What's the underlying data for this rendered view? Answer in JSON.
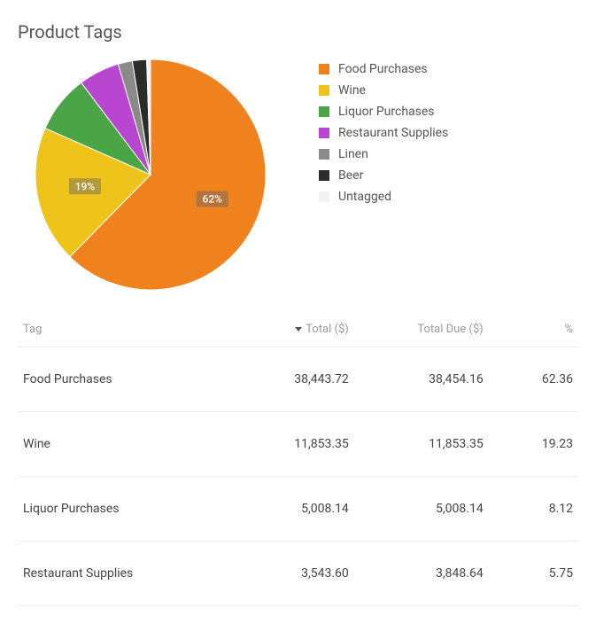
{
  "title": "Product Tags",
  "chart_data": {
    "type": "pie",
    "title": "Product Tags",
    "series": [
      {
        "name": "Food Purchases",
        "percent": 62.36,
        "color": "#f0821e"
      },
      {
        "name": "Wine",
        "percent": 19.23,
        "color": "#eec31a"
      },
      {
        "name": "Liquor Purchases",
        "percent": 8.12,
        "color": "#4aa547"
      },
      {
        "name": "Restaurant Supplies",
        "percent": 5.75,
        "color": "#b946d1"
      },
      {
        "name": "Linen",
        "percent": 2.0,
        "color": "#8a8a8a"
      },
      {
        "name": "Beer",
        "percent": 2.0,
        "color": "#2c2c2c"
      },
      {
        "name": "Untagged",
        "percent": 0.54,
        "color": "#f2f2f2"
      }
    ],
    "visible_labels": [
      {
        "text": "62%",
        "for": "Food Purchases"
      },
      {
        "text": "19%",
        "for": "Wine"
      }
    ]
  },
  "legend": [
    {
      "label": "Food Purchases",
      "color": "#f0821e"
    },
    {
      "label": "Wine",
      "color": "#eec31a"
    },
    {
      "label": "Liquor Purchases",
      "color": "#4aa547"
    },
    {
      "label": "Restaurant Supplies",
      "color": "#b946d1"
    },
    {
      "label": "Linen",
      "color": "#8a8a8a"
    },
    {
      "label": "Beer",
      "color": "#2c2c2c"
    },
    {
      "label": "Untagged",
      "color": "#f2f2f2"
    }
  ],
  "table": {
    "columns": {
      "tag": "Tag",
      "total": "Total ($)",
      "due": "Total Due ($)",
      "pct": "%"
    },
    "sort_column": "total",
    "rows": [
      {
        "tag": "Food Purchases",
        "total": "38,443.72",
        "due": "38,454.16",
        "pct": "62.36"
      },
      {
        "tag": "Wine",
        "total": "11,853.35",
        "due": "11,853.35",
        "pct": "19.23"
      },
      {
        "tag": "Liquor Purchases",
        "total": "5,008.14",
        "due": "5,008.14",
        "pct": "8.12"
      },
      {
        "tag": "Restaurant Supplies",
        "total": "3,543.60",
        "due": "3,848.64",
        "pct": "5.75"
      }
    ]
  }
}
